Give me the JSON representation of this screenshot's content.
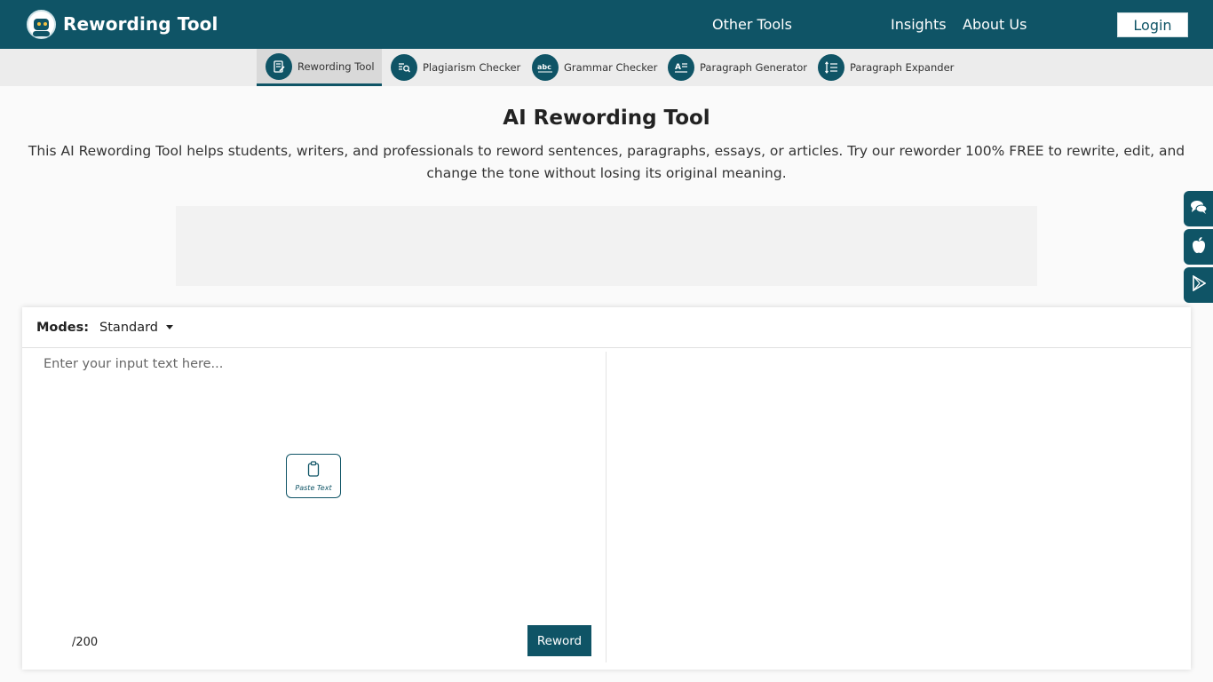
{
  "header": {
    "brand_name": "Rewording Tool",
    "nav": {
      "other_tools": "Other Tools",
      "insights": "Insights",
      "about_us": "About Us"
    },
    "login_label": "Login",
    "brand_color": "#0f5466"
  },
  "tools_bar": {
    "items": [
      {
        "label": "Rewording Tool",
        "icon": "document-edit-icon",
        "active": true
      },
      {
        "label": "Plagiarism Checker",
        "icon": "search-lines-icon",
        "active": false
      },
      {
        "label": "Grammar Checker",
        "icon": "abc-check-icon",
        "active": false
      },
      {
        "label": "Paragraph Generator",
        "icon": "text-lines-icon",
        "active": false
      },
      {
        "label": "Paragraph Expander",
        "icon": "expand-lines-icon",
        "active": false
      }
    ]
  },
  "main": {
    "title": "AI Rewording Tool",
    "description": "This AI Rewording Tool helps students, writers, and professionals to reword sentences, paragraphs, essays, or articles. Try our reworder 100% FREE to rewrite, edit, and change the tone without losing its original meaning."
  },
  "side_buttons": [
    {
      "icon": "chat-icon"
    },
    {
      "icon": "apple-icon"
    },
    {
      "icon": "play-store-icon"
    }
  ],
  "editor": {
    "modes_label": "Modes:",
    "selected_mode": "Standard",
    "input_placeholder": "Enter your input text here...",
    "paste_label": "Paste Text",
    "counter": "/200",
    "reword_label": "Reword"
  }
}
